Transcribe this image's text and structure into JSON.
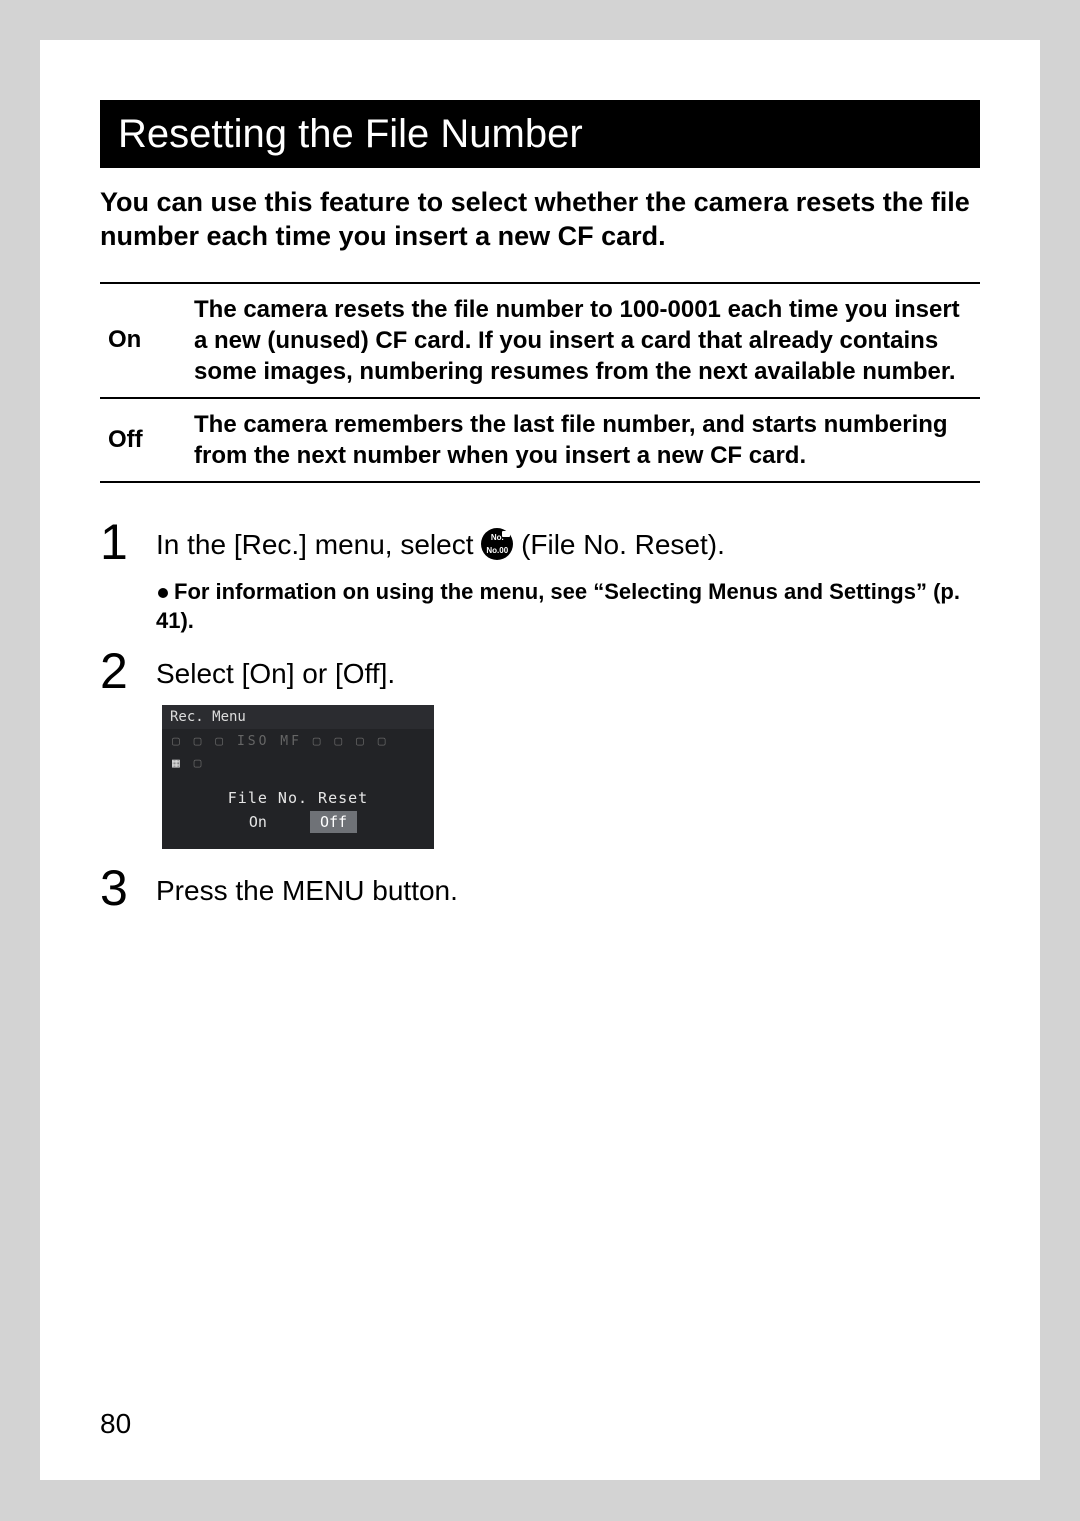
{
  "heading": "Resetting the File Number",
  "intro": "You can use this feature to select whether the camera resets the file number each time you insert a new CF card.",
  "table": {
    "rows": [
      {
        "label": "On",
        "description": "The camera resets the file number to 100-0001 each time you insert a new (unused) CF card. If you insert a card that already contains some images, numbering resumes from the next available number."
      },
      {
        "label": "Off",
        "description": "The camera remembers the last file number, and starts numbering from the next number when you insert a new CF card."
      }
    ]
  },
  "steps": [
    {
      "number": "1",
      "text_before_icon": "In the [Rec.] menu, select ",
      "text_after_icon": " (File No. Reset).",
      "note_prefix": "For information on using the menu, see ",
      "note_quoted": "“Selecting Menus and Settings”",
      "note_suffix": " (p. 41)."
    },
    {
      "number": "2",
      "text": "Select [On] or [Off].",
      "screenshot": {
        "title": "Rec. Menu",
        "icon_row1": "▢ ▢ ▢ ISO MF ▢ ▢ ▢ ▢",
        "icon_row2_hl": "▦ ",
        "icon_row2_rest": "▢",
        "setting_label": "File No. Reset",
        "options": [
          "On",
          "Off"
        ],
        "selected_index": 1
      }
    },
    {
      "number": "3",
      "text": "Press the MENU button."
    }
  ],
  "page_number": "80",
  "icon": {
    "top_text": "No.",
    "bot_text": "No.00"
  }
}
